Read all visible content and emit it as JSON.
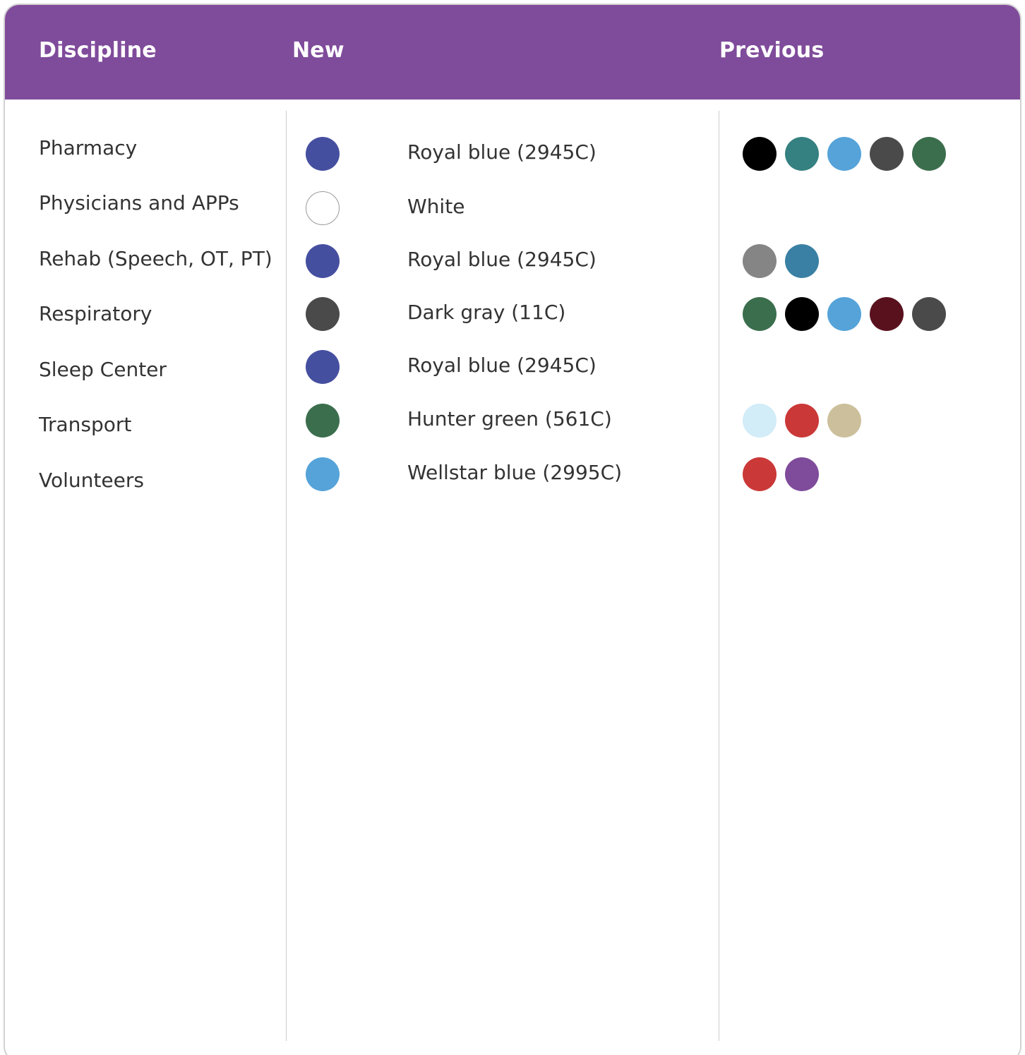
{
  "header": {
    "discipline": "Discipline",
    "new": "New",
    "previous": "Previous"
  },
  "rows": [
    {
      "discipline": "Pharmacy",
      "new_color": "#454fa0",
      "new_name": "Royal blue (2945C)",
      "previous": [
        "#000000",
        "#358080",
        "#55a3d9",
        "#4a4a4a",
        "#3b6e4d"
      ]
    },
    {
      "discipline": "Physicians and APPs",
      "new_color": "#ffffff",
      "new_name": "White",
      "previous": []
    },
    {
      "discipline": "Rehab (Speech, OT, PT)",
      "new_color": "#454fa0",
      "new_name": "Royal blue (2945C)",
      "previous": [
        "#858585",
        "#3a80a4"
      ]
    },
    {
      "discipline": "Respiratory",
      "new_color": "#4a4a4a",
      "new_name": "Dark gray (11C)",
      "previous": [
        "#3b6e4d",
        "#000000",
        "#55a3d9",
        "#5a111e",
        "#4a4a4a"
      ]
    },
    {
      "discipline": "Sleep Center",
      "new_color": "#454fa0",
      "new_name": "Royal blue (2945C)",
      "previous": []
    },
    {
      "discipline": "Transport",
      "new_color": "#3b6e4d",
      "new_name": "Hunter green (561C)",
      "previous": [
        "#d2ecf8",
        "#cb3838",
        "#ccc09c"
      ]
    },
    {
      "discipline": "Volunteers",
      "new_color": "#55a3d9",
      "new_name": "Wellstar blue (2995C)",
      "previous": [
        "#cb3838",
        "#7f4b9b"
      ]
    }
  ]
}
